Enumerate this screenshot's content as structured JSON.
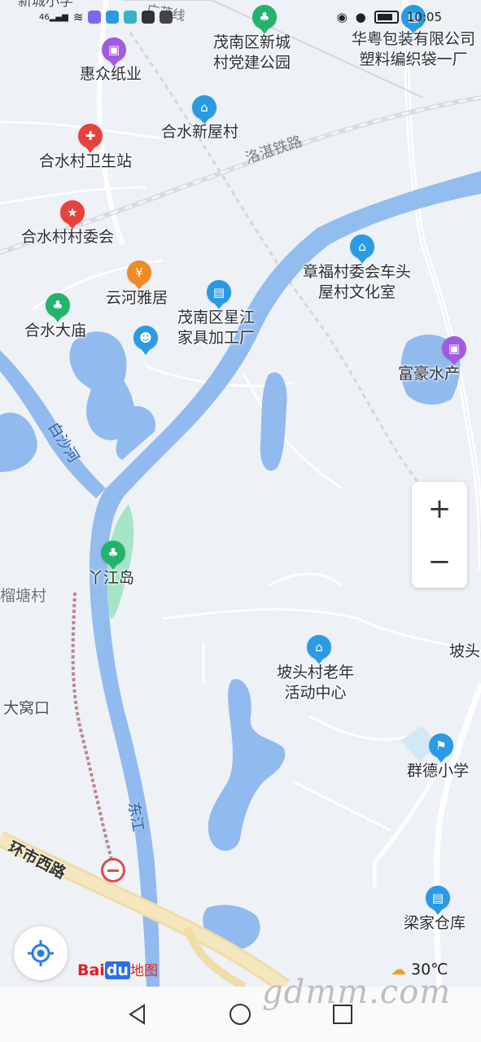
{
  "status_bar": {
    "signal": "46",
    "time": "10:05"
  },
  "map": {
    "pois": [
      {
        "id": "p1",
        "text": "茂南区新城\n村党建公园",
        "icon": "park-icon",
        "color": "green"
      },
      {
        "id": "p2",
        "text": "华粤包装有限公司\n塑料编织袋一厂",
        "icon": "building-icon",
        "color": "blue"
      },
      {
        "id": "p3",
        "text": "惠众纸业",
        "icon": "shop-bag-icon",
        "color": "purple"
      },
      {
        "id": "p4",
        "text": "合水新屋村",
        "icon": "village-icon",
        "color": "blue"
      },
      {
        "id": "p5",
        "text": "合水村卫生站",
        "icon": "clinic-icon",
        "color": "red"
      },
      {
        "id": "p6",
        "text": "合水村村委会",
        "icon": "government-icon",
        "color": "red"
      },
      {
        "id": "p7",
        "text": "章福村委会车头\n屋村文化室",
        "icon": "culture-icon",
        "color": "blue"
      },
      {
        "id": "p8",
        "text": "云河雅居",
        "icon": "restaurant-icon",
        "color": "orange"
      },
      {
        "id": "p9",
        "text": "茂南区星江\n家具加工厂",
        "icon": "factory-icon",
        "color": "blue"
      },
      {
        "id": "p10",
        "text": "合水大庙",
        "icon": "temple-icon",
        "color": "green"
      },
      {
        "id": "p11",
        "text": "富豪水产",
        "icon": "shop-bag-icon",
        "color": "purple"
      },
      {
        "id": "p12",
        "text": "丫江岛",
        "icon": "park-icon",
        "color": "green"
      },
      {
        "id": "p13",
        "text": "坡头村老年\n活动中心",
        "icon": "culture-icon",
        "color": "blue"
      },
      {
        "id": "p14",
        "text": "群德小学",
        "icon": "school-icon",
        "color": "blue"
      },
      {
        "id": "p15",
        "text": "梁家仓库",
        "icon": "warehouse-icon",
        "color": "blue"
      },
      {
        "id": "p16",
        "text": "坡头",
        "icon": "",
        "color": ""
      }
    ],
    "place_labels": {
      "liutang": "榴塘村",
      "dawokou": "大窝口",
      "top_left": "新城小学"
    },
    "road_labels": {
      "railway": "洛湛铁路",
      "top_road": "广茂线",
      "huanshi": "环市西路",
      "river_baisha": "白沙河",
      "river_dongjiang": "东江"
    },
    "restroom_icon": "restroom-icon",
    "zoom_in": "+",
    "zoom_out": "−",
    "logo_text": "Bai",
    "logo_du": "du",
    "logo_cn": "地图",
    "weather": "30℃"
  },
  "watermark": "gdmm.com"
}
